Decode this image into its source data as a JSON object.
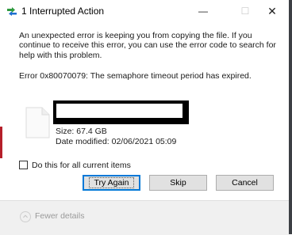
{
  "window": {
    "title": "1 Interrupted Action",
    "minimize_glyph": "—",
    "maximize_glyph": "☐",
    "close_glyph": "✕"
  },
  "message": {
    "body": "An unexpected error is keeping you from copying the file. If you continue to receive this error, you can use the error code to search for help with this problem.",
    "error": "Error 0x80070079: The semaphore timeout period has expired."
  },
  "file": {
    "name": "",
    "size": "Size: 67.4 GB",
    "date_modified": "Date modified: 02/06/2021 05:09",
    "icon": "file-icon"
  },
  "checkbox": {
    "label": "Do this for all current items",
    "checked": false
  },
  "buttons": {
    "try_again": "Try Again",
    "skip": "Skip",
    "cancel": "Cancel"
  },
  "footer": {
    "fewer_details": "Fewer details"
  },
  "colors": {
    "focus_border": "#0078d7",
    "button_face": "#e1e1e1",
    "footer_bg": "#f0f0f0"
  }
}
